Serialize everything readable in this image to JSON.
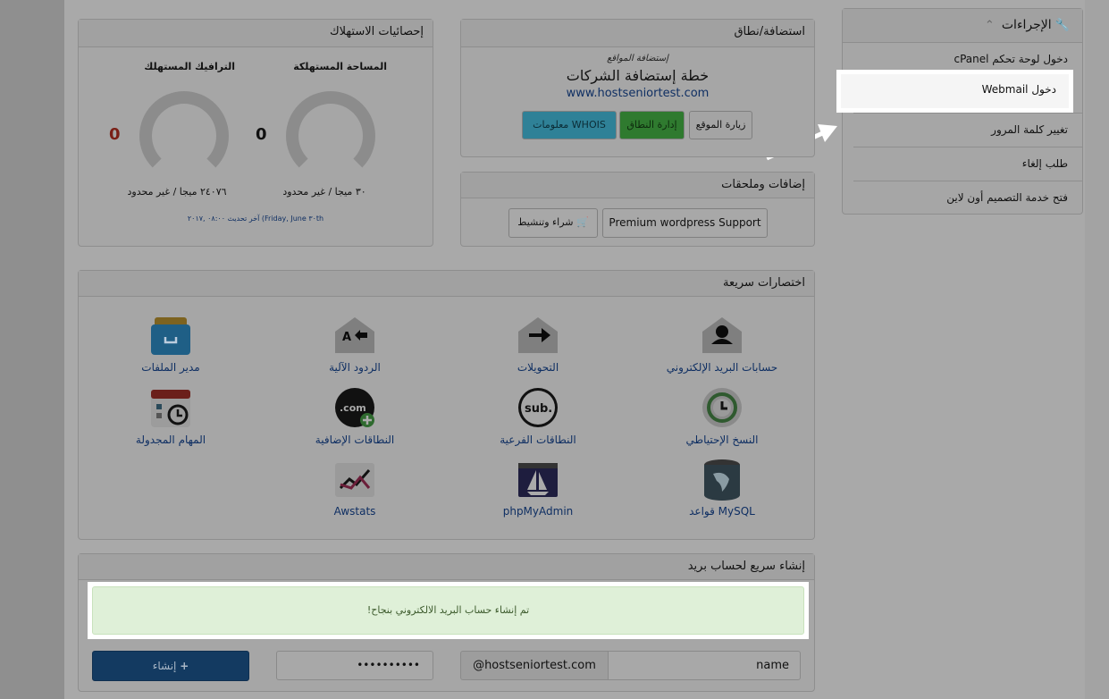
{
  "actions": {
    "title": "الإجراءات",
    "items": [
      {
        "label": "دخول لوحة تحكم cPanel"
      },
      {
        "label": "دخول Webmail"
      },
      {
        "label": "تغيير كلمة المرور"
      },
      {
        "label": "طلب إلغاء"
      },
      {
        "label": "فتح خدمة التصميم أون لاين"
      }
    ]
  },
  "hosting": {
    "title": "استضافة/نطاق",
    "subtitle": "إستضافة المواقع",
    "plan": "خطة إستضافة الشركات",
    "domain": "www.hostseniortest.com",
    "btn_visit": "زيارة الموقع",
    "btn_manage": "إدارة النطاق",
    "btn_whois": "معلومات WHOIS"
  },
  "addons": {
    "title": "إضافات وملحقات",
    "btn_buy": "شراء وتنشيط",
    "btn_wp": "Premium wordpress Support"
  },
  "stats": {
    "title": "إحصائيات الاستهلاك",
    "disk_label": "المساحة المستهلكة",
    "disk_value": "0",
    "disk_text": "٣٠ ميجا / غير محدود",
    "bw_label": "الترافيك المستهلك",
    "bw_value": "0",
    "bw_text": "٢٤٠٧٦ ميجا / غير محدود",
    "updated": "آخر تحديث ٠٨:٠٠ ,٢٠١٧ (Friday, June ٣٠th"
  },
  "shortcuts": {
    "title": "اختصارات سريعة",
    "items": [
      {
        "label": "حسابات البريد الإلكتروني",
        "icon": "email-account-icon"
      },
      {
        "label": "التحويلات",
        "icon": "forwarders-icon"
      },
      {
        "label": "الردود الآلية",
        "icon": "autoresponders-icon"
      },
      {
        "label": "مدير الملفات",
        "icon": "file-manager-icon"
      },
      {
        "label": "النسخ الإحتياطي",
        "icon": "backup-icon"
      },
      {
        "label": "النطاقات الفرعية",
        "icon": "subdomains-icon"
      },
      {
        "label": "النطاقات الإضافية",
        "icon": "addon-domains-icon"
      },
      {
        "label": "المهام المجدولة",
        "icon": "cron-jobs-icon"
      },
      {
        "label": "قواعد MySQL",
        "icon": "mysql-icon"
      },
      {
        "label": "phpMyAdmin",
        "icon": "phpmyadmin-icon"
      },
      {
        "label": "Awstats",
        "icon": "awstats-icon"
      }
    ]
  },
  "quick_email": {
    "title": "إنشاء سريع لحساب بريد",
    "success": "تم إنشاء حساب البريد الالكتروني بنجاح!",
    "name_placeholder": "name",
    "domain_suffix": "@hostseniortest.com",
    "password_value": "••••••••••",
    "create_label": "إنشاء"
  },
  "colors": {
    "green": "#3c9a3c",
    "teal": "#3ab0c8",
    "blue": "#215d9b",
    "red": "#c0392b"
  }
}
